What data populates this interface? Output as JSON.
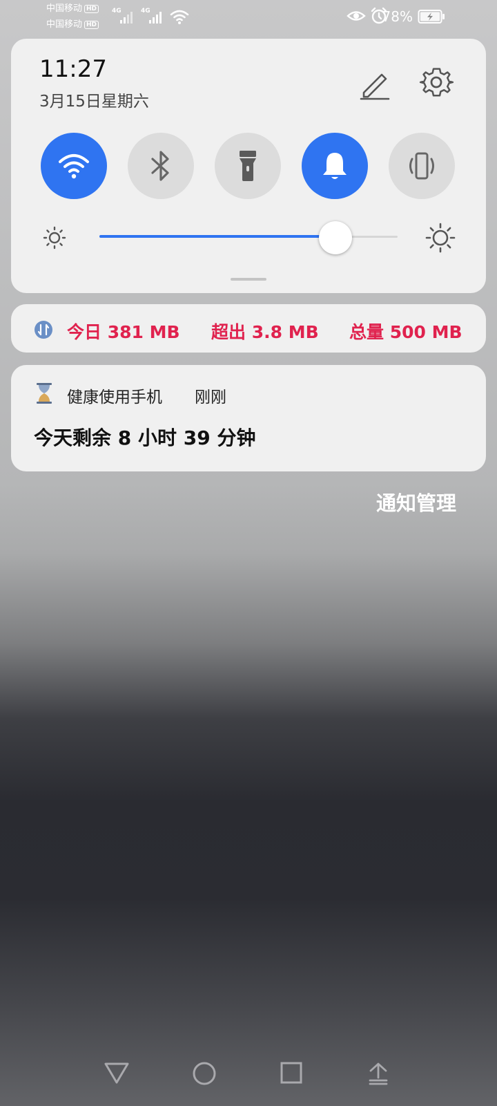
{
  "status_bar": {
    "carrier_1": "中国移动",
    "carrier_2": "中国移动",
    "hd_badge": "HD",
    "network_1": "4G",
    "network_2": "4G",
    "battery_percent": "78%",
    "icons": [
      "signal-icon",
      "wifi-icon",
      "eye-icon",
      "alarm-icon",
      "battery-charging-icon"
    ]
  },
  "quick_panel": {
    "time": "11:27",
    "date": "3月15日星期六",
    "toggles": [
      {
        "name": "wifi",
        "state": "on"
      },
      {
        "name": "bluetooth",
        "state": "off"
      },
      {
        "name": "flashlight",
        "state": "off"
      },
      {
        "name": "sound",
        "state": "on"
      },
      {
        "name": "vibrate",
        "state": "off"
      }
    ],
    "brightness_fraction": 0.8,
    "accent_color": "#2f74f1"
  },
  "data_usage": {
    "today": "今日 381 MB",
    "exceeded": "超出 3.8 MB",
    "total": "总量 500 MB",
    "alert_color": "#e0224e"
  },
  "notification": {
    "app_name": "健康使用手机",
    "time": "刚刚",
    "body": "今天剩余 8 小时 39 分钟"
  },
  "manage_label": "通知管理",
  "nav_bar": [
    "back-icon",
    "home-icon",
    "recents-icon",
    "collapse-icon"
  ]
}
